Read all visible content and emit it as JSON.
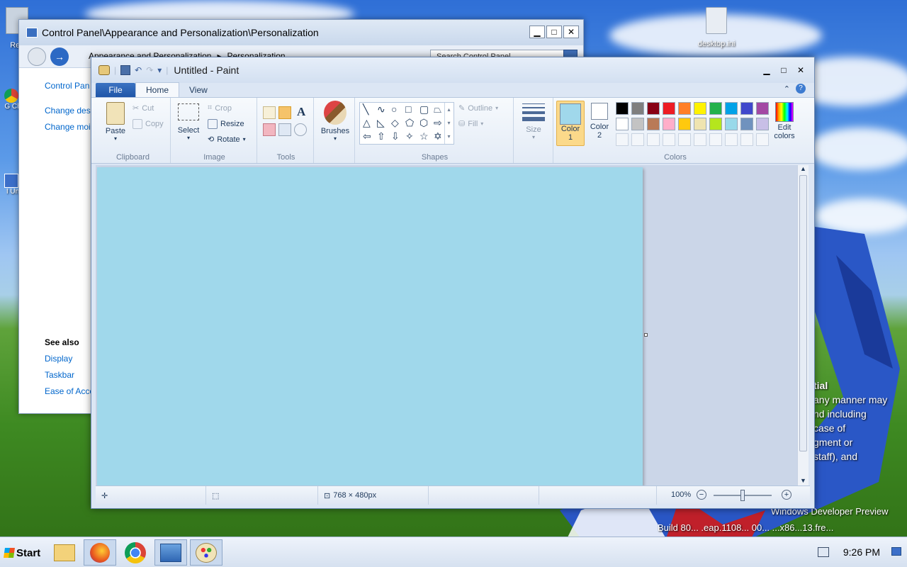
{
  "desktop": {
    "icons": [
      {
        "label": "Rec"
      },
      {
        "label": "G Ch"
      },
      {
        "label": "I Un"
      },
      {
        "label": "desktop.ini"
      }
    ],
    "watermark_lines": [
      "tial",
      "any manner may",
      "nd including",
      "case of",
      "gment or",
      "staff), and",
      "Windows Developer Preview",
      "Build 80... .eap.1108... 00... ...x86...13.fre..."
    ]
  },
  "control_panel": {
    "title": "Control Panel\\Appearance and Personalization\\Personalization",
    "breadcrumb": [
      "Appearance and Personalization",
      "Personalization"
    ],
    "search_placeholder": "Search Control Panel",
    "links": [
      "Control Pan",
      "Change desl",
      "Change moi"
    ],
    "see_also_label": "See also",
    "see_also_links": [
      "Display",
      "Taskbar",
      "Ease of Acce"
    ]
  },
  "paint": {
    "title": "Untitled - Paint",
    "tabs": [
      "File",
      "Home",
      "View"
    ],
    "clipboard": {
      "paste": "Paste",
      "cut": "Cut",
      "copy": "Copy",
      "label": "Clipboard"
    },
    "image": {
      "select": "Select",
      "crop": "Crop",
      "resize": "Resize",
      "rotate": "Rotate",
      "label": "Image"
    },
    "tools": {
      "label": "Tools"
    },
    "brushes": {
      "label": "Brushes"
    },
    "shapes": {
      "outline": "Outline",
      "fill": "Fill",
      "label": "Shapes"
    },
    "size": {
      "label": "Size"
    },
    "color1": {
      "label": "Color",
      "num": "1",
      "value": "#a0d8eb"
    },
    "color2": {
      "label": "Color",
      "num": "2",
      "value": "#ffffff"
    },
    "colors_label": "Colors",
    "edit_colors": {
      "line1": "Edit",
      "line2": "colors"
    },
    "palette_row1": [
      "#000000",
      "#7f7f7f",
      "#880015",
      "#ed1c24",
      "#ff7f27",
      "#fff200",
      "#22b14c",
      "#00a2e8",
      "#3f48cc",
      "#a349a4"
    ],
    "palette_row2": [
      "#ffffff",
      "#c3c3c3",
      "#b97a57",
      "#ffaec9",
      "#ffc90e",
      "#efe4b0",
      "#b5e61d",
      "#99d9ea",
      "#7092be",
      "#c8bfe7"
    ],
    "canvas_color": "#a0d8eb",
    "status": {
      "dimensions": "768 × 480px",
      "zoom": "100%"
    }
  },
  "taskbar": {
    "start_label": "Start",
    "apps": [
      "file-explorer",
      "firefox",
      "chrome",
      "control-panel",
      "paint"
    ],
    "time": "9:26 PM"
  }
}
